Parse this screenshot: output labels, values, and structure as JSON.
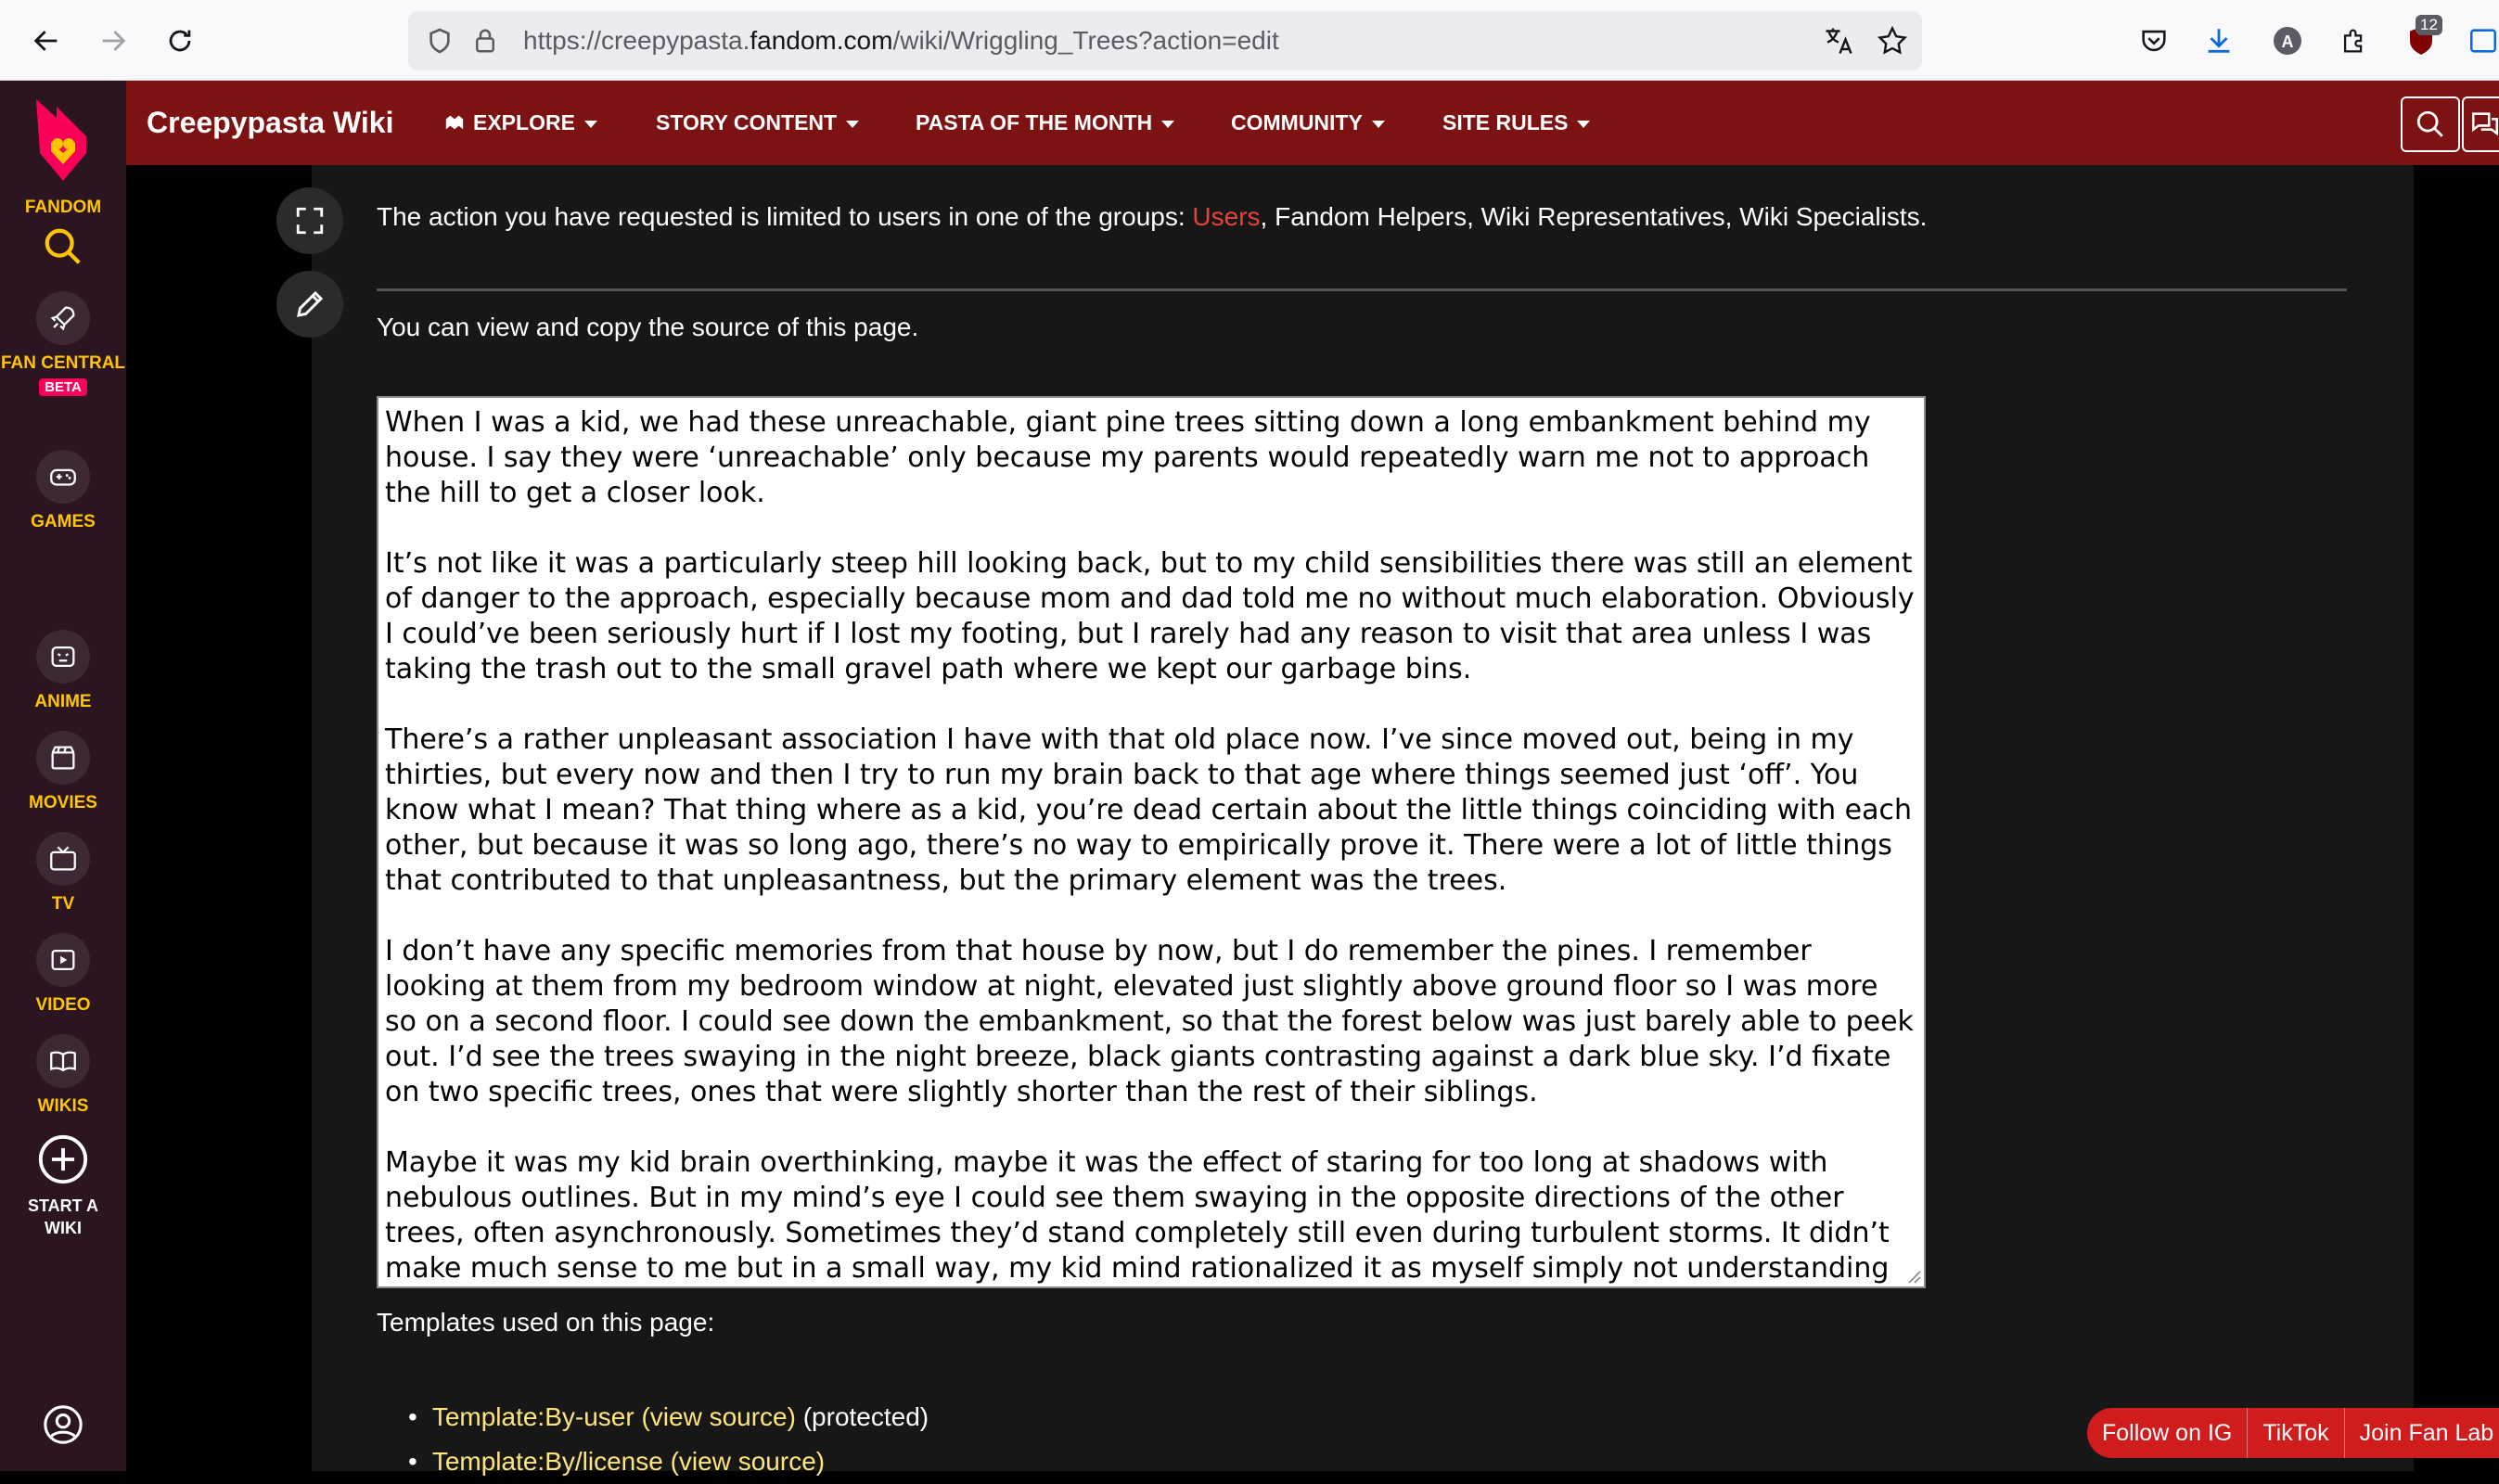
{
  "browser": {
    "url_prefix": "https://creepypasta.",
    "url_domain": "fandom.com",
    "url_suffix": "/wiki/Wriggling_Trees?action=edit",
    "extensions_badge": "12"
  },
  "rail": {
    "fandom_label": "FANDOM",
    "fan_central_label": "FAN CENTRAL",
    "beta_label": "BETA",
    "games_label": "GAMES",
    "anime_label": "ANIME",
    "movies_label": "MOVIES",
    "tv_label": "TV",
    "video_label": "VIDEO",
    "wikis_label": "WIKIS",
    "start_wiki_label": "START A WIKI"
  },
  "header": {
    "wiki_name": "Creepypasta Wiki",
    "nav": [
      {
        "label": "EXPLORE"
      },
      {
        "label": "STORY CONTENT"
      },
      {
        "label": "PASTA OF THE MONTH"
      },
      {
        "label": "COMMUNITY"
      },
      {
        "label": "SITE RULES"
      }
    ]
  },
  "main": {
    "notice_prefix": "The action you have requested is limited to users in one of the groups: ",
    "notice_link": "Users",
    "notice_suffix": ", Fandom Helpers, Wiki Representatives, Wiki Specialists.",
    "view_copy_text": "You can view and copy the source of this page.",
    "source_text": "When I was a kid, we had these unreachable, giant pine trees sitting down a long embankment behind my house. I say they were ‘unreachable’ only because my parents would repeatedly warn me not to approach the hill to get a closer look.\n\nIt’s not like it was a particularly steep hill looking back, but to my child sensibilities there was still an element of danger to the approach, especially because mom and dad told me no without much elaboration. Obviously I could’ve been seriously hurt if I lost my footing, but I rarely had any reason to visit that area unless I was taking the trash out to the small gravel path where we kept our garbage bins.\n\nThere’s a rather unpleasant association I have with that old place now. I’ve since moved out, being in my thirties, but every now and then I try to run my brain back to that age where things seemed just ‘off’. You know what I mean? That thing where as a kid, you’re dead certain about the little things coinciding with each other, but because it was so long ago, there’s no way to empirically prove it. There were a lot of little things that contributed to that unpleasantness, but the primary element was the trees.\n\nI don’t have any specific memories from that house by now, but I do remember the pines. I remember looking at them from my bedroom window at night, elevated just slightly above ground floor so I was more so on a second floor. I could see down the embankment, so that the forest below was just barely able to peek out. I’d see the trees swaying in the night breeze, black giants contrasting against a dark blue sky. I’d fixate on two specific trees, ones that were slightly shorter than the rest of their siblings.\n\nMaybe it was my kid brain overthinking, maybe it was the effect of staring for too long at shadows with nebulous outlines. But in my mind’s eye I could see them swaying in the opposite directions of the other trees, often asynchronously. Sometimes they’d stand completely still even during turbulent storms. It didn’t make much sense to me but in a small way, my kid mind rationalized it as myself simply not understanding all the",
    "templates_title": "Templates used on this page:",
    "templates": [
      {
        "name": "Template:By-user",
        "view": "(view source)",
        "note": "(protected)"
      },
      {
        "name": "Template:By/license",
        "view": "(view source)",
        "note": ""
      }
    ]
  },
  "promo": {
    "items": [
      "Follow on IG",
      "TikTok",
      "Join Fan Lab"
    ]
  },
  "colors": {
    "rail_bg": "#2a1521",
    "header_bg": "#7c1212",
    "accent_yellow": "#ffc500",
    "link_red": "#e94234",
    "template_link": "#ffe57a",
    "promo_red": "#d01c1c"
  }
}
